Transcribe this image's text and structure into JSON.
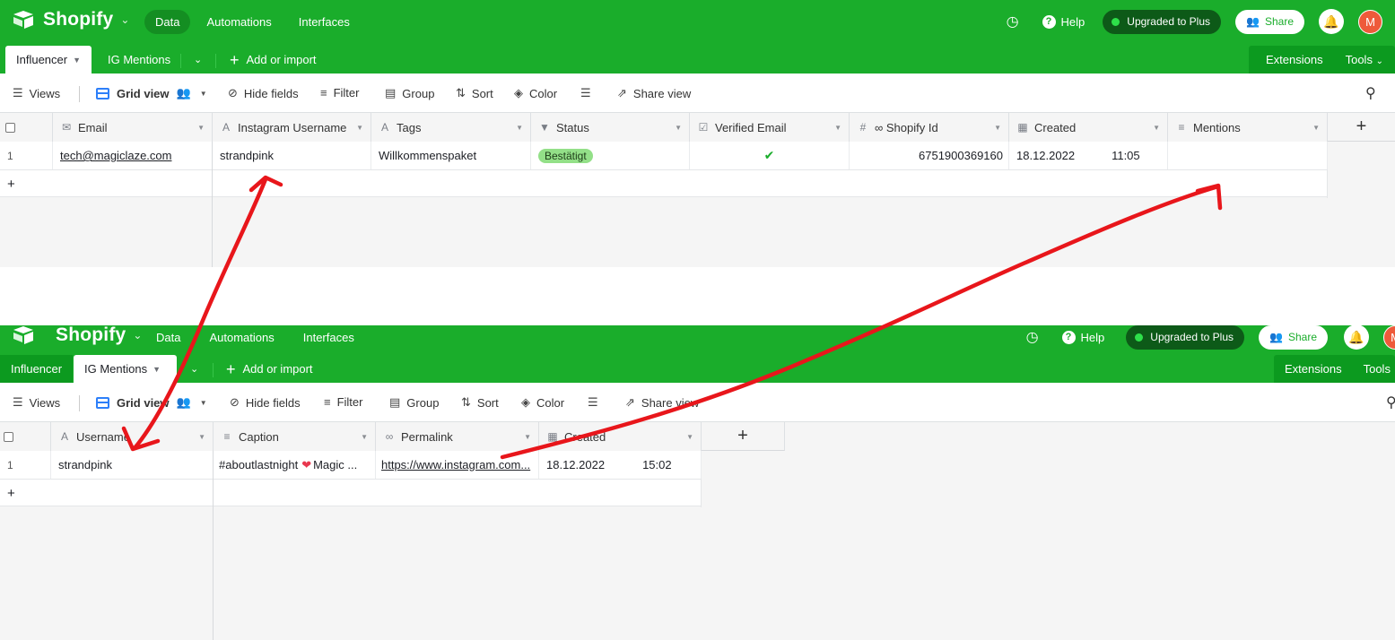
{
  "app": {
    "brand": "Shopify",
    "nav": [
      "Data",
      "Automations",
      "Interfaces"
    ],
    "help": "Help",
    "plan": "Upgraded to Plus",
    "share": "Share",
    "avatar": "M"
  },
  "colors": {
    "topbar": "#1aad2b",
    "accent_blue": "#2d7ff9",
    "badge": "#93e088",
    "annotation": "#e8161b"
  },
  "tabs": {
    "influencer": "Influencer",
    "ig_mentions": "IG Mentions",
    "add_import": "Add or import",
    "extensions": "Extensions",
    "tools": "Tools"
  },
  "toolbar": {
    "views": "Views",
    "grid_view": "Grid view",
    "hide_fields": "Hide fields",
    "filter": "Filter",
    "group": "Group",
    "sort": "Sort",
    "color": "Color",
    "share_view": "Share view"
  },
  "influencer_table": {
    "columns": [
      "Email",
      "Instagram Username",
      "Tags",
      "Status",
      "Verified Email",
      "∞ Shopify Id",
      "Created",
      "Mentions"
    ],
    "rows": [
      {
        "num": "1",
        "email": "tech@magiclaze.com",
        "username": "strandpink",
        "tags": "Willkommenspaket",
        "status": "Bestätigt",
        "verified": "✔",
        "shopify_id": "6751900369160",
        "created_date": "18.12.2022",
        "created_time": "11:05",
        "mentions": ""
      }
    ]
  },
  "mentions_table": {
    "columns": [
      "Username",
      "Caption",
      "Permalink",
      "Created"
    ],
    "rows": [
      {
        "num": "1",
        "username": "strandpink",
        "caption_a": "#aboutlastnight",
        "caption_b": "Magic ...",
        "permalink": "https://www.instagram.com...",
        "created_date": "18.12.2022",
        "created_time": "15:02"
      }
    ]
  },
  "add_row": "+",
  "add_field": "+"
}
